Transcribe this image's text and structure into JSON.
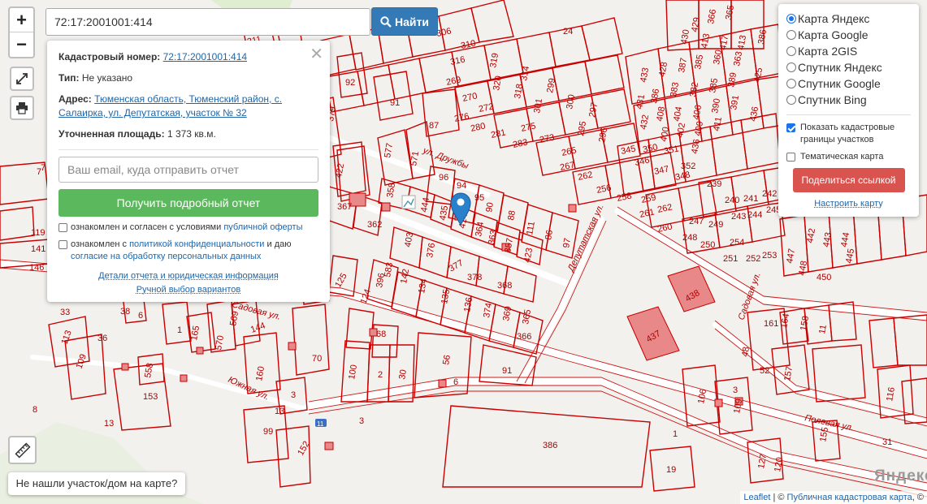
{
  "search": {
    "value": "72:17:2001001:414",
    "button_label": "Найти"
  },
  "popup": {
    "cadastral_label": "Кадастровый номер:",
    "cadastral_value": "72:17:2001001:414",
    "type_label": "Тип:",
    "type_value": "Не указано",
    "address_label": "Адрес:",
    "address_value": "Тюменская область, Тюменский район, с. Салаирка, ул. Депутатская, участок № 32",
    "area_label": "Уточненная площадь:",
    "area_value": "1 373 кв.м.",
    "email_placeholder": "Ваш email, куда отправить отчет",
    "report_button": "Получить подробный отчет",
    "agree1_text": "ознакомлен и согласен с условиями ",
    "agree1_link": "публичной оферты",
    "agree2_text": "ознакомлен с ",
    "agree2_link": "политикой конфиденциальности",
    "agree2_text2": " и даю",
    "agree2_link2": "согласие на обработку персональных данных",
    "details_link": "Детали отчета и юридическая информация",
    "manual_link": "Ручной выбор вариантов"
  },
  "layers": {
    "base_maps": [
      {
        "label": "Карта Яндекс",
        "selected": true
      },
      {
        "label": "Карта Google",
        "selected": false
      },
      {
        "label": "Карта 2GIS",
        "selected": false
      },
      {
        "label": "Спутник Яндекс",
        "selected": false
      },
      {
        "label": "Спутник Google",
        "selected": false
      },
      {
        "label": "Спутник Bing",
        "selected": false
      }
    ],
    "show_cadastral_label": "Показать кадастровые границы участков",
    "show_cadastral_checked": true,
    "thematic_label": "Тематическая карта",
    "thematic_checked": false,
    "share_button": "Поделиться ссылкой",
    "setup_link": "Настроить карту"
  },
  "zoom": {
    "in": "+",
    "out": "−"
  },
  "notfound_button": "Не нашли участок/дом на карте?",
  "attribution": {
    "leaflet": "Leaflet",
    "sep": " | © ",
    "pkk": "Публичная кадастровая карта",
    "tail": ", ©"
  },
  "watermark": "Яндекс",
  "colors": {
    "boundary": "#c80000",
    "road": "#ffffff",
    "building": "#e88888",
    "primary": "#337ab7",
    "success": "#5cb85c",
    "danger": "#d9534f"
  },
  "map_labels": {
    "streets": [
      "ул. Дружбы",
      "Депутатская ул.",
      "Южная ул.",
      "Садовая ул.",
      "Полевая ул.",
      "Садовая ул."
    ],
    "plot_numbers": [
      "24",
      "311",
      "306",
      "310",
      "316",
      "319",
      "314",
      "320",
      "318",
      "301",
      "299",
      "297",
      "295",
      "296",
      "300",
      "302",
      "304",
      "298",
      "292",
      "291",
      "293",
      "284",
      "286",
      "272",
      "274",
      "276",
      "282",
      "280",
      "281",
      "283",
      "285",
      "275",
      "269",
      "270",
      "271",
      "277",
      "273",
      "265",
      "264",
      "263",
      "262",
      "261",
      "260",
      "259",
      "258",
      "256",
      "257",
      "266",
      "267",
      "268",
      "422",
      "577",
      "571",
      "96",
      "94",
      "95",
      "90",
      "88",
      "111",
      "86",
      "97",
      "87",
      "91",
      "92",
      "379",
      "358",
      "444",
      "435",
      "414",
      "364",
      "363",
      "357",
      "423",
      "362",
      "367",
      "403",
      "376",
      "377",
      "378",
      "368",
      "396",
      "583",
      "142",
      "134",
      "135",
      "136",
      "374",
      "369",
      "365",
      "366",
      "125",
      "124",
      "113",
      "109",
      "6",
      "1",
      "165",
      "569",
      "144",
      "160",
      "570",
      "70",
      "68",
      "56",
      "100",
      "2",
      "30",
      "91",
      "1",
      "558",
      "153",
      "3",
      "99",
      "152",
      "386",
      "438",
      "437",
      "106",
      "109",
      "127",
      "120",
      "155",
      "19",
      "48",
      "52",
      "157",
      "161",
      "164",
      "158",
      "11",
      "116",
      "429",
      "413",
      "381",
      "386",
      "387",
      "433",
      "428",
      "425",
      "426",
      "431",
      "432",
      "434",
      "408",
      "404",
      "406",
      "400",
      "402",
      "409",
      "411",
      "436",
      "345",
      "350",
      "351",
      "346",
      "347",
      "348",
      "349",
      "352",
      "353",
      "239",
      "240",
      "241",
      "242",
      "243",
      "244",
      "245",
      "247",
      "248",
      "249",
      "250",
      "251",
      "252",
      "253",
      "254",
      "255",
      "442",
      "443",
      "444",
      "447",
      "448",
      "449",
      "450",
      "445",
      "119",
      "146",
      "141",
      "413",
      "417",
      "413",
      "430",
      "417"
    ],
    "building_numbers": [
      "438",
      "437"
    ]
  }
}
